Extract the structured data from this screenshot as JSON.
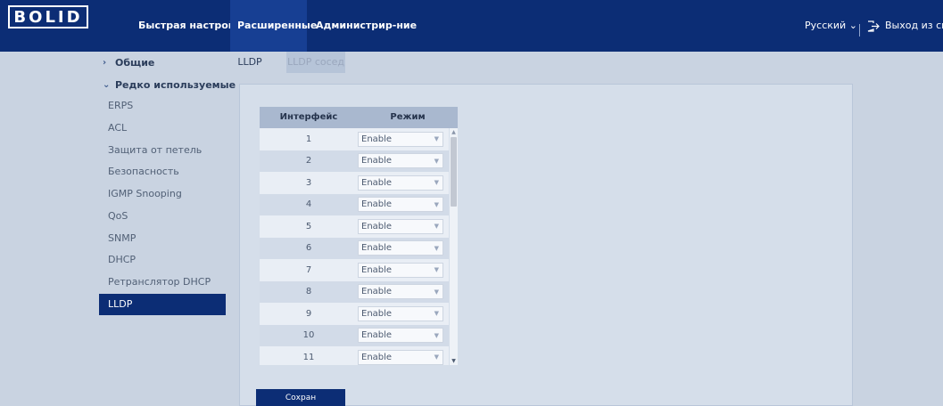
{
  "header": {
    "logo_text": "BOLID",
    "nav": [
      "Быстрая настройка",
      "Расширенные",
      "Администрир-ние"
    ],
    "language": "Русский",
    "logout": "Выход из систем"
  },
  "sidebar": {
    "groups": [
      {
        "label": "Общие",
        "chevron": "›"
      },
      {
        "label": "Редко используемые",
        "chevron": "⌄"
      }
    ],
    "items": [
      "ERPS",
      "ACL",
      "Защита от петель",
      "Безопасность",
      "IGMP Snooping",
      "QoS",
      "SNMP",
      "DHCP",
      "Ретранслятор DHCP",
      "LLDP"
    ],
    "active": "LLDP"
  },
  "tabs": [
    "LLDP",
    "LLDP сосед"
  ],
  "table": {
    "headers": [
      "Интерфейс",
      "Режим"
    ],
    "rows": [
      {
        "interface": "1",
        "mode": "Enable"
      },
      {
        "interface": "2",
        "mode": "Enable"
      },
      {
        "interface": "3",
        "mode": "Enable"
      },
      {
        "interface": "4",
        "mode": "Enable"
      },
      {
        "interface": "5",
        "mode": "Enable"
      },
      {
        "interface": "6",
        "mode": "Enable"
      },
      {
        "interface": "7",
        "mode": "Enable"
      },
      {
        "interface": "8",
        "mode": "Enable"
      },
      {
        "interface": "9",
        "mode": "Enable"
      },
      {
        "interface": "10",
        "mode": "Enable"
      },
      {
        "interface": "11",
        "mode": "Enable"
      }
    ]
  },
  "save_label": "Сохран",
  "colors": {
    "topbar": "#0c2d75",
    "active": "#0c2d75",
    "panel": "#d5deea",
    "background": "#c9d3e1"
  },
  "icons": {
    "logout": "logout-icon",
    "dropdown": "chevron-down-icon"
  }
}
